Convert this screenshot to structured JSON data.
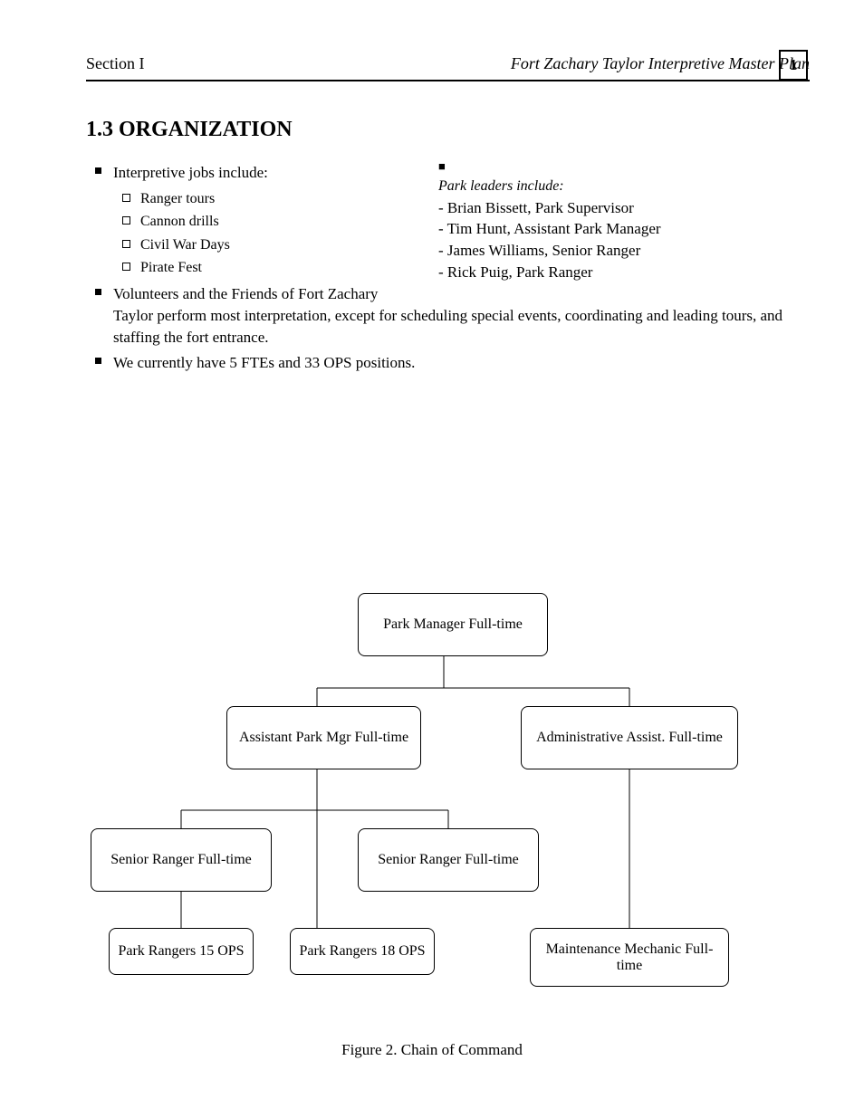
{
  "header": {
    "left": "Section I",
    "right": "Fort Zachary Taylor Interpretive Master Plan",
    "page": "1"
  },
  "section": {
    "title": "1.3 ORGANIZATION"
  },
  "leaders": {
    "heading": "Park leaders include:",
    "items": [
      "- Brian Bissett, Park Supervisor",
      "- Tim Hunt, Assistant Park Manager",
      "- James Williams, Senior Ranger",
      "- Rick Puig, Park Ranger"
    ]
  },
  "bullets": [
    {
      "lead": "Interpretive jobs include:",
      "sub": [
        "Ranger tours",
        "Cannon drills",
        "Civil War Days",
        "Pirate Fest"
      ]
    },
    {
      "text": "Volunteers and the Friends of Fort Zachary Taylor perform most interpretation, except for scheduling special events, coordinating and leading tours, and staffing the fort entrance."
    },
    {
      "text": "We currently have 5 FTEs and 33 OPS positions."
    }
  ],
  "chart": {
    "nodes": [
      "Park Manager\nFull-time",
      "Assistant Park Mgr\nFull-time",
      "Administrative Assist.\nFull-time",
      "Senior Ranger\nFull-time",
      "Senior Ranger\nFull-time",
      "Park Rangers\n15 OPS",
      "Park Rangers\n18 OPS",
      "Maintenance Mechanic\nFull-time"
    ],
    "caption": "Figure 2. Chain of Command"
  }
}
